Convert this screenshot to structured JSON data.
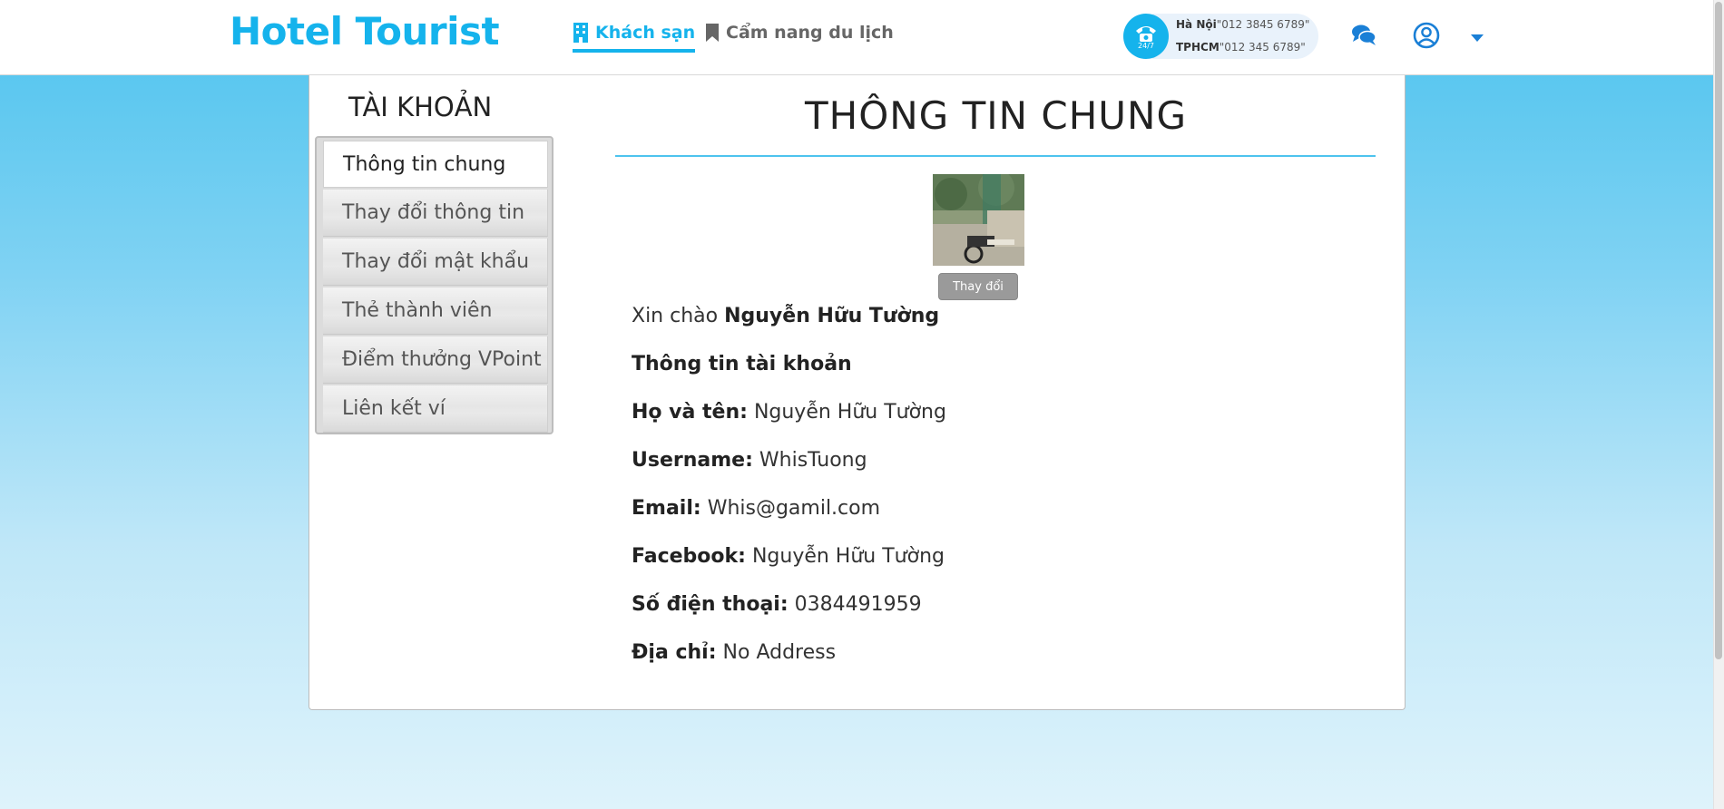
{
  "header": {
    "logo": "Hotel Tourist",
    "nav": [
      {
        "label": "Khách sạn",
        "icon": "building-icon",
        "active": true
      },
      {
        "label": "Cẩm nang du lịch",
        "icon": "bookmark-icon",
        "active": false
      }
    ],
    "hotline": {
      "badge": "24/7",
      "hanoi_label": "Hà Nội",
      "hanoi_number": "\"012 3845 6789\"",
      "hcm_label": "TPHCM",
      "hcm_number": "\"012 345 6789\""
    },
    "icons": [
      "chat-icon",
      "user-circle-icon",
      "caret-down-icon"
    ]
  },
  "sidebar": {
    "title": "TÀI KHOẢN",
    "items": [
      {
        "label": "Thông tin chung",
        "active": true
      },
      {
        "label": "Thay đổi thông tin",
        "active": false
      },
      {
        "label": "Thay đổi mật khẩu",
        "active": false
      },
      {
        "label": "Thẻ thành viên",
        "active": false
      },
      {
        "label": "Điểm thưởng VPoint",
        "active": false
      },
      {
        "label": "Liên kết ví",
        "active": false
      }
    ]
  },
  "main": {
    "title": "THÔNG TIN CHUNG",
    "change_avatar_label": "Thay đổi",
    "greeting_prefix": "Xin chào",
    "greeting_name": "Nguyễn Hữu Tường",
    "section_heading": "Thông tin tài khoản",
    "fields": [
      {
        "label": "Họ và tên:",
        "value": "Nguyễn Hữu Tường"
      },
      {
        "label": "Username:",
        "value": "WhisTuong"
      },
      {
        "label": "Email:",
        "value": "Whis@gamil.com"
      },
      {
        "label": "Facebook:",
        "value": "Nguyễn Hữu Tường"
      },
      {
        "label": "Số điện thoại:",
        "value": "0384491959"
      },
      {
        "label": "Địa chỉ:",
        "value": "No Address"
      }
    ]
  },
  "colors": {
    "brand": "#15b3ec",
    "background_top": "#4dc3ee",
    "background_bottom": "#def3fb"
  }
}
